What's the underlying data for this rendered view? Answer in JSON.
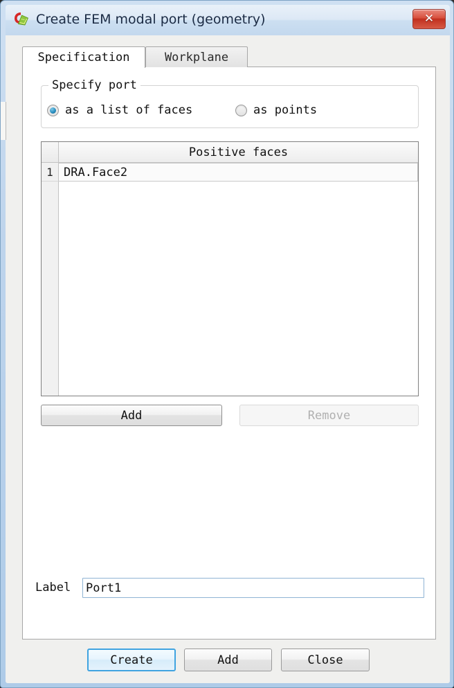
{
  "window": {
    "title": "Create FEM modal port (geometry)",
    "icon": "cst-application-icon",
    "close_label": "✕",
    "close_icon": "close-icon",
    "frame_color": "#aecbe8",
    "titlebar_color": "#dce8f5"
  },
  "tabs": [
    {
      "label": "Specification",
      "active": true
    },
    {
      "label": "Workplane",
      "active": false
    }
  ],
  "specify_port": {
    "group_title": "Specify port",
    "options": [
      {
        "label": "as a list of faces",
        "checked": true
      },
      {
        "label": "as points",
        "checked": false
      }
    ]
  },
  "faces_table": {
    "column_header": "Positive faces",
    "rows": [
      {
        "index": "1",
        "value": "DRA.Face2"
      }
    ]
  },
  "list_buttons": {
    "add_label": "Add",
    "add_enabled": true,
    "remove_label": "Remove",
    "remove_enabled": false
  },
  "label_field": {
    "caption": "Label",
    "value": "Port1",
    "placeholder": ""
  },
  "footer_buttons": [
    {
      "label": "Create",
      "default": true
    },
    {
      "label": "Add",
      "default": false
    },
    {
      "label": "Close",
      "default": false
    }
  ],
  "colors": {
    "accent_blue": "#3fa3e0",
    "radio_selected": "#2a8fc0",
    "close_red": "#c1301f",
    "dialog_bg": "#f0f0ee",
    "panel_bg": "#ffffff"
  }
}
